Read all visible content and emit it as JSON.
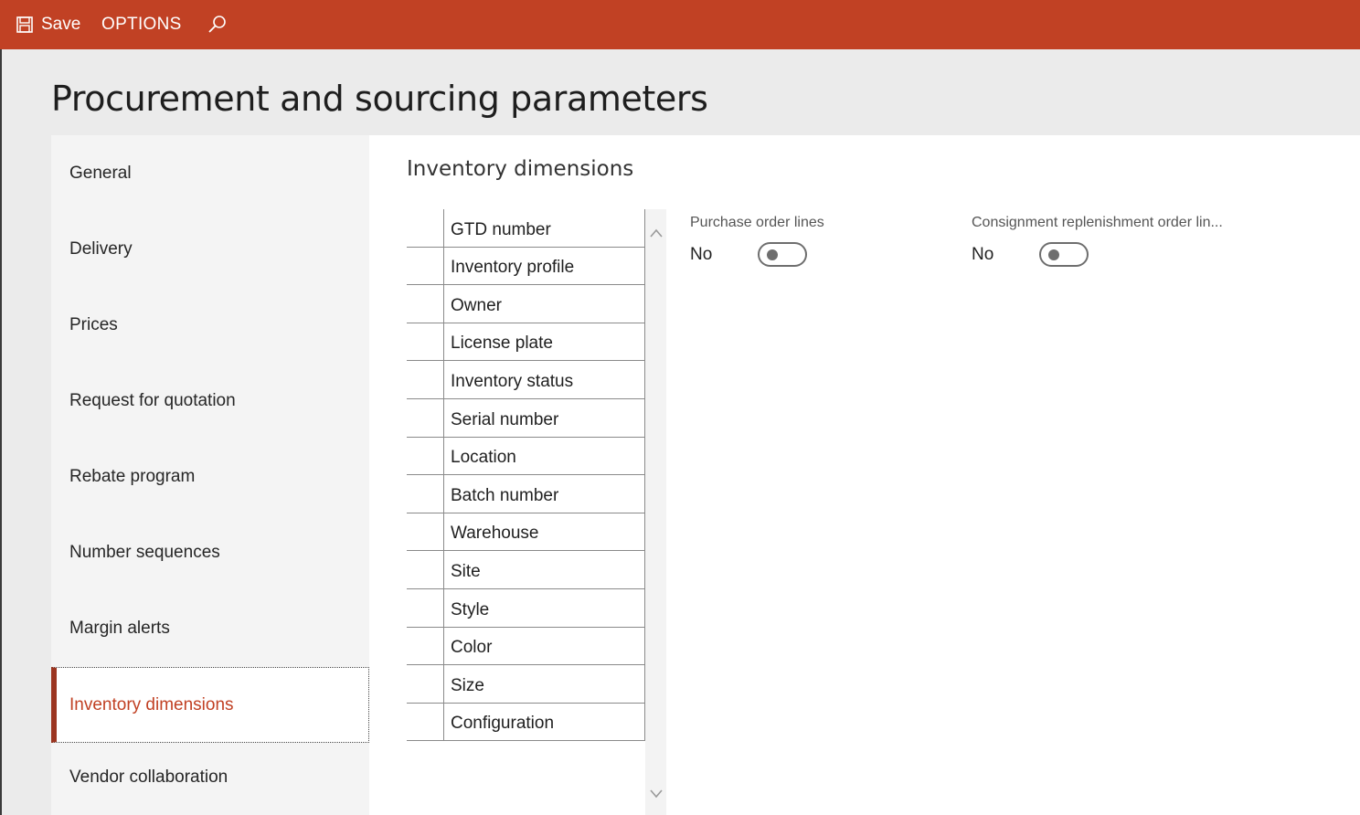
{
  "toolbar": {
    "save_label": "Save",
    "options_label": "OPTIONS",
    "save_icon": "save-icon",
    "search_icon": "search-icon"
  },
  "page": {
    "title": "Procurement and sourcing parameters"
  },
  "nav": {
    "items": [
      {
        "label": "General"
      },
      {
        "label": "Delivery"
      },
      {
        "label": "Prices"
      },
      {
        "label": "Request for quotation"
      },
      {
        "label": "Rebate program"
      },
      {
        "label": "Number sequences"
      },
      {
        "label": "Margin alerts"
      },
      {
        "label": "Inventory dimensions"
      },
      {
        "label": "Vendor collaboration"
      }
    ],
    "active": "Inventory dimensions"
  },
  "section": {
    "title": "Inventory dimensions",
    "dimensions": [
      {
        "label": "GTD number"
      },
      {
        "label": "Inventory profile"
      },
      {
        "label": "Owner"
      },
      {
        "label": "License plate"
      },
      {
        "label": "Inventory status"
      },
      {
        "label": "Serial number"
      },
      {
        "label": "Location"
      },
      {
        "label": "Batch number"
      },
      {
        "label": "Warehouse"
      },
      {
        "label": "Site"
      },
      {
        "label": "Style"
      },
      {
        "label": "Color"
      },
      {
        "label": "Size"
      },
      {
        "label": "Configuration"
      }
    ],
    "fields": [
      {
        "label": "Purchase order lines",
        "value": "No"
      },
      {
        "label": "Consignment replenishment order lin...",
        "value": "No"
      }
    ]
  },
  "colors": {
    "accent": "#c14124",
    "active_bar": "#9b3520"
  }
}
